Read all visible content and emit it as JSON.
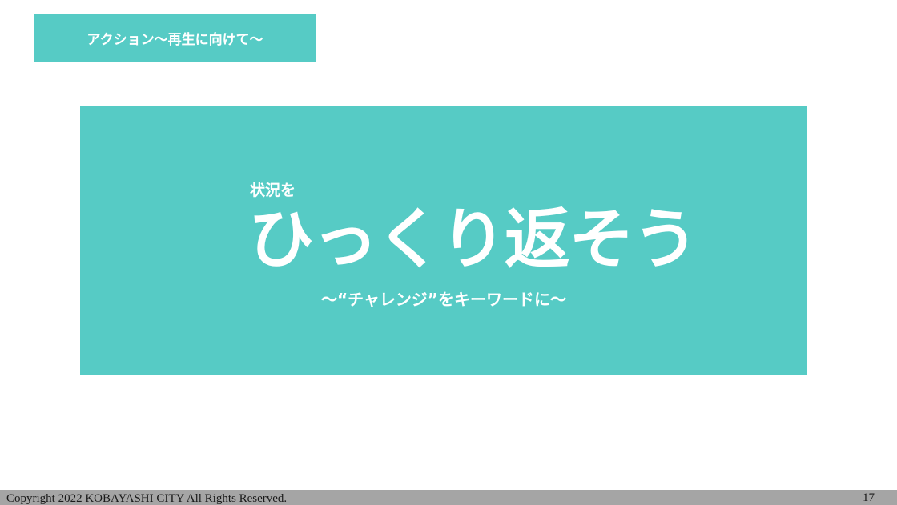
{
  "section_tag": {
    "label": "アクション～再生に向けて～"
  },
  "hero": {
    "kicker": "状況を",
    "title": "ひっくり返そう",
    "subtitle": "～“チャレンジ”をキーワードに～"
  },
  "footer": {
    "copyright": "Copyright 2022 KOBAYASHI CITY All Rights Reserved.",
    "page_number": "17"
  },
  "colors": {
    "accent": "#56CBC5",
    "footer_bar": "#A5A5A5",
    "text_on_accent": "#FFFFFF"
  }
}
